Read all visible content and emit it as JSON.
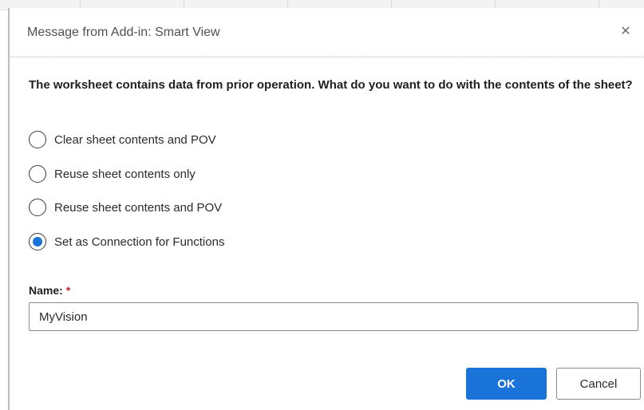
{
  "dialog": {
    "title": "Message from Add-in: Smart View",
    "close_symbol": "✕",
    "question": "The worksheet contains data from prior operation. What do you want to do with the contents of the sheet?"
  },
  "options": [
    {
      "label": "Clear sheet contents and POV",
      "selected": false
    },
    {
      "label": "Reuse sheet contents only",
      "selected": false
    },
    {
      "label": "Reuse sheet contents and POV",
      "selected": false
    },
    {
      "label": "Set as Connection for Functions",
      "selected": true
    }
  ],
  "name_field": {
    "label": "Name:",
    "required_marker": "*",
    "value": "MyVision"
  },
  "buttons": {
    "ok_label": "OK",
    "cancel_label": "Cancel"
  },
  "colors": {
    "accent": "#1a73d9",
    "required": "#c4262e"
  },
  "icons": {
    "close": "close-icon",
    "radio_unchecked": "radio-unchecked-icon",
    "radio_checked": "radio-checked-icon"
  }
}
